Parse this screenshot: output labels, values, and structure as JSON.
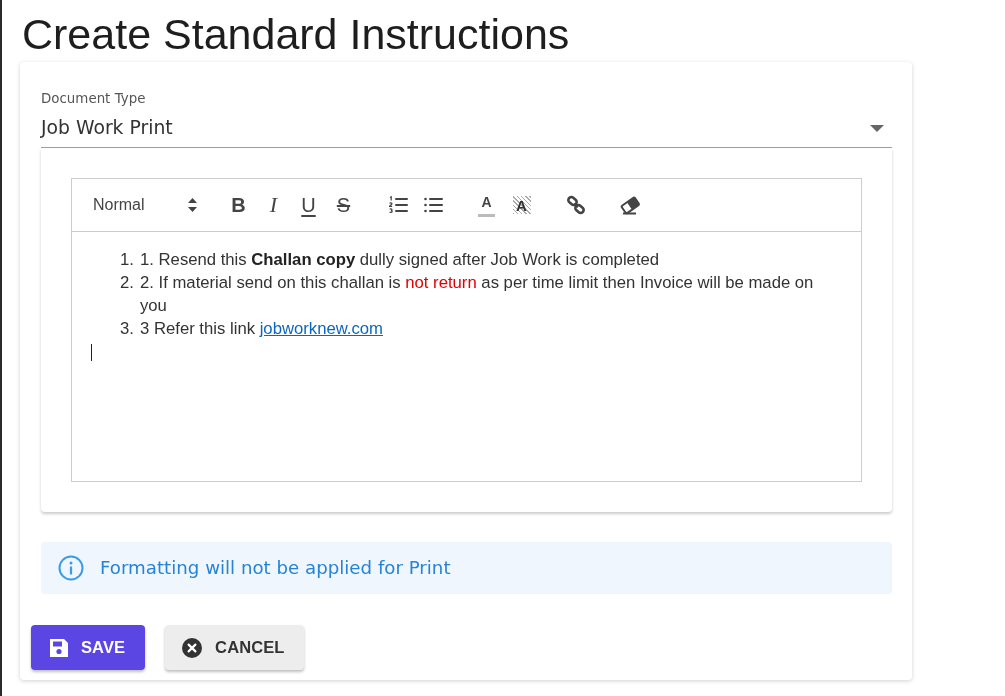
{
  "page": {
    "title": "Create Standard Instructions"
  },
  "document_type": {
    "label": "Document Type",
    "value": "Job Work Print"
  },
  "editor": {
    "toolbar": {
      "format": "Normal",
      "groups": [
        [
          {
            "kind": "bold",
            "glyph": "B"
          },
          {
            "kind": "italic",
            "glyph": "I"
          },
          {
            "kind": "underline",
            "glyph": "U"
          },
          {
            "kind": "strike",
            "glyph": "S"
          }
        ],
        [
          {
            "kind": "ordered-list"
          },
          {
            "kind": "bullet-list"
          }
        ],
        [
          {
            "kind": "color",
            "glyph": "A"
          },
          {
            "kind": "background",
            "glyph": "A"
          }
        ],
        [
          {
            "kind": "link"
          }
        ],
        [
          {
            "kind": "clean"
          }
        ]
      ]
    },
    "items": [
      {
        "number": "1.",
        "segments": [
          {
            "kind": "text",
            "text": "1. Resend this **Challan copy** dully signed after Job Work is completed"
          }
        ]
      },
      {
        "number": "2.",
        "segments": [
          {
            "kind": "text",
            "text": "2. If material send on this challan is "
          },
          {
            "kind": "warning",
            "text": "not return"
          },
          {
            "kind": "text",
            "text": " as per time limit then Invoice will be made on you"
          }
        ]
      },
      {
        "number": "3.",
        "segments": [
          {
            "kind": "text",
            "text": "3 Refer this link "
          },
          {
            "kind": "link",
            "text": "jobworknew.com"
          }
        ]
      }
    ],
    "cursor": true
  },
  "notice": {
    "kind": "info",
    "text": "Formatting will not be applied for Print"
  },
  "buttons": [
    {
      "kind": "save",
      "label": "SAVE"
    },
    {
      "kind": "cancel",
      "label": "CANCEL"
    }
  ]
}
